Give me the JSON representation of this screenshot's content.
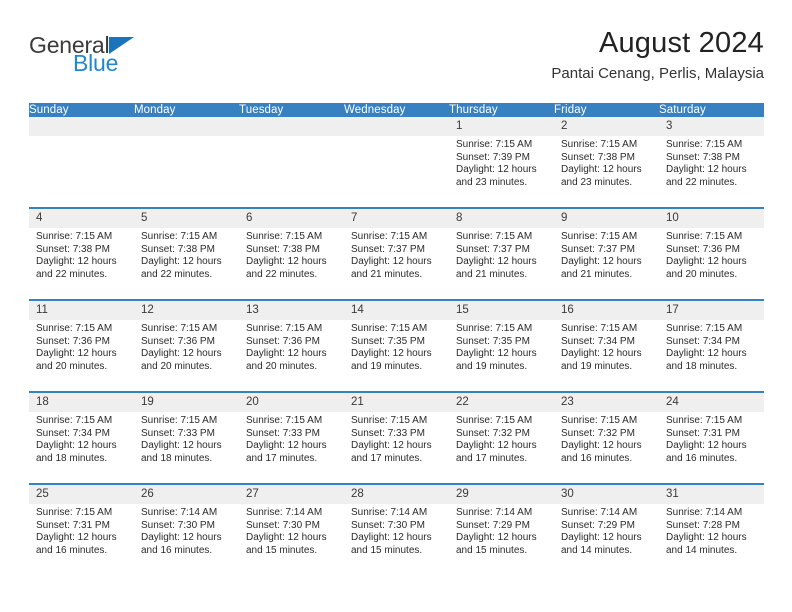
{
  "brand": {
    "line1": "General",
    "line2": "Blue",
    "triangle_icon": "blue-triangle-icon",
    "color_text": "#3b3b3b",
    "color_blue": "#2387d0"
  },
  "header": {
    "title": "August 2024",
    "subtitle": "Pantai Cenang, Perlis, Malaysia"
  },
  "colors": {
    "header_bar": "#3781c2",
    "daynum_band": "#efefef",
    "rule": "#3781c2"
  },
  "weekdays": [
    "Sunday",
    "Monday",
    "Tuesday",
    "Wednesday",
    "Thursday",
    "Friday",
    "Saturday"
  ],
  "weeks": [
    [
      {
        "day": "",
        "sunrise": "",
        "sunset": "",
        "daylight1": "",
        "daylight2": ""
      },
      {
        "day": "",
        "sunrise": "",
        "sunset": "",
        "daylight1": "",
        "daylight2": ""
      },
      {
        "day": "",
        "sunrise": "",
        "sunset": "",
        "daylight1": "",
        "daylight2": ""
      },
      {
        "day": "",
        "sunrise": "",
        "sunset": "",
        "daylight1": "",
        "daylight2": ""
      },
      {
        "day": "1",
        "sunrise": "Sunrise: 7:15 AM",
        "sunset": "Sunset: 7:39 PM",
        "daylight1": "Daylight: 12 hours",
        "daylight2": "and 23 minutes."
      },
      {
        "day": "2",
        "sunrise": "Sunrise: 7:15 AM",
        "sunset": "Sunset: 7:38 PM",
        "daylight1": "Daylight: 12 hours",
        "daylight2": "and 23 minutes."
      },
      {
        "day": "3",
        "sunrise": "Sunrise: 7:15 AM",
        "sunset": "Sunset: 7:38 PM",
        "daylight1": "Daylight: 12 hours",
        "daylight2": "and 22 minutes."
      }
    ],
    [
      {
        "day": "4",
        "sunrise": "Sunrise: 7:15 AM",
        "sunset": "Sunset: 7:38 PM",
        "daylight1": "Daylight: 12 hours",
        "daylight2": "and 22 minutes."
      },
      {
        "day": "5",
        "sunrise": "Sunrise: 7:15 AM",
        "sunset": "Sunset: 7:38 PM",
        "daylight1": "Daylight: 12 hours",
        "daylight2": "and 22 minutes."
      },
      {
        "day": "6",
        "sunrise": "Sunrise: 7:15 AM",
        "sunset": "Sunset: 7:38 PM",
        "daylight1": "Daylight: 12 hours",
        "daylight2": "and 22 minutes."
      },
      {
        "day": "7",
        "sunrise": "Sunrise: 7:15 AM",
        "sunset": "Sunset: 7:37 PM",
        "daylight1": "Daylight: 12 hours",
        "daylight2": "and 21 minutes."
      },
      {
        "day": "8",
        "sunrise": "Sunrise: 7:15 AM",
        "sunset": "Sunset: 7:37 PM",
        "daylight1": "Daylight: 12 hours",
        "daylight2": "and 21 minutes."
      },
      {
        "day": "9",
        "sunrise": "Sunrise: 7:15 AM",
        "sunset": "Sunset: 7:37 PM",
        "daylight1": "Daylight: 12 hours",
        "daylight2": "and 21 minutes."
      },
      {
        "day": "10",
        "sunrise": "Sunrise: 7:15 AM",
        "sunset": "Sunset: 7:36 PM",
        "daylight1": "Daylight: 12 hours",
        "daylight2": "and 20 minutes."
      }
    ],
    [
      {
        "day": "11",
        "sunrise": "Sunrise: 7:15 AM",
        "sunset": "Sunset: 7:36 PM",
        "daylight1": "Daylight: 12 hours",
        "daylight2": "and 20 minutes."
      },
      {
        "day": "12",
        "sunrise": "Sunrise: 7:15 AM",
        "sunset": "Sunset: 7:36 PM",
        "daylight1": "Daylight: 12 hours",
        "daylight2": "and 20 minutes."
      },
      {
        "day": "13",
        "sunrise": "Sunrise: 7:15 AM",
        "sunset": "Sunset: 7:36 PM",
        "daylight1": "Daylight: 12 hours",
        "daylight2": "and 20 minutes."
      },
      {
        "day": "14",
        "sunrise": "Sunrise: 7:15 AM",
        "sunset": "Sunset: 7:35 PM",
        "daylight1": "Daylight: 12 hours",
        "daylight2": "and 19 minutes."
      },
      {
        "day": "15",
        "sunrise": "Sunrise: 7:15 AM",
        "sunset": "Sunset: 7:35 PM",
        "daylight1": "Daylight: 12 hours",
        "daylight2": "and 19 minutes."
      },
      {
        "day": "16",
        "sunrise": "Sunrise: 7:15 AM",
        "sunset": "Sunset: 7:34 PM",
        "daylight1": "Daylight: 12 hours",
        "daylight2": "and 19 minutes."
      },
      {
        "day": "17",
        "sunrise": "Sunrise: 7:15 AM",
        "sunset": "Sunset: 7:34 PM",
        "daylight1": "Daylight: 12 hours",
        "daylight2": "and 18 minutes."
      }
    ],
    [
      {
        "day": "18",
        "sunrise": "Sunrise: 7:15 AM",
        "sunset": "Sunset: 7:34 PM",
        "daylight1": "Daylight: 12 hours",
        "daylight2": "and 18 minutes."
      },
      {
        "day": "19",
        "sunrise": "Sunrise: 7:15 AM",
        "sunset": "Sunset: 7:33 PM",
        "daylight1": "Daylight: 12 hours",
        "daylight2": "and 18 minutes."
      },
      {
        "day": "20",
        "sunrise": "Sunrise: 7:15 AM",
        "sunset": "Sunset: 7:33 PM",
        "daylight1": "Daylight: 12 hours",
        "daylight2": "and 17 minutes."
      },
      {
        "day": "21",
        "sunrise": "Sunrise: 7:15 AM",
        "sunset": "Sunset: 7:33 PM",
        "daylight1": "Daylight: 12 hours",
        "daylight2": "and 17 minutes."
      },
      {
        "day": "22",
        "sunrise": "Sunrise: 7:15 AM",
        "sunset": "Sunset: 7:32 PM",
        "daylight1": "Daylight: 12 hours",
        "daylight2": "and 17 minutes."
      },
      {
        "day": "23",
        "sunrise": "Sunrise: 7:15 AM",
        "sunset": "Sunset: 7:32 PM",
        "daylight1": "Daylight: 12 hours",
        "daylight2": "and 16 minutes."
      },
      {
        "day": "24",
        "sunrise": "Sunrise: 7:15 AM",
        "sunset": "Sunset: 7:31 PM",
        "daylight1": "Daylight: 12 hours",
        "daylight2": "and 16 minutes."
      }
    ],
    [
      {
        "day": "25",
        "sunrise": "Sunrise: 7:15 AM",
        "sunset": "Sunset: 7:31 PM",
        "daylight1": "Daylight: 12 hours",
        "daylight2": "and 16 minutes."
      },
      {
        "day": "26",
        "sunrise": "Sunrise: 7:14 AM",
        "sunset": "Sunset: 7:30 PM",
        "daylight1": "Daylight: 12 hours",
        "daylight2": "and 16 minutes."
      },
      {
        "day": "27",
        "sunrise": "Sunrise: 7:14 AM",
        "sunset": "Sunset: 7:30 PM",
        "daylight1": "Daylight: 12 hours",
        "daylight2": "and 15 minutes."
      },
      {
        "day": "28",
        "sunrise": "Sunrise: 7:14 AM",
        "sunset": "Sunset: 7:30 PM",
        "daylight1": "Daylight: 12 hours",
        "daylight2": "and 15 minutes."
      },
      {
        "day": "29",
        "sunrise": "Sunrise: 7:14 AM",
        "sunset": "Sunset: 7:29 PM",
        "daylight1": "Daylight: 12 hours",
        "daylight2": "and 15 minutes."
      },
      {
        "day": "30",
        "sunrise": "Sunrise: 7:14 AM",
        "sunset": "Sunset: 7:29 PM",
        "daylight1": "Daylight: 12 hours",
        "daylight2": "and 14 minutes."
      },
      {
        "day": "31",
        "sunrise": "Sunrise: 7:14 AM",
        "sunset": "Sunset: 7:28 PM",
        "daylight1": "Daylight: 12 hours",
        "daylight2": "and 14 minutes."
      }
    ]
  ]
}
